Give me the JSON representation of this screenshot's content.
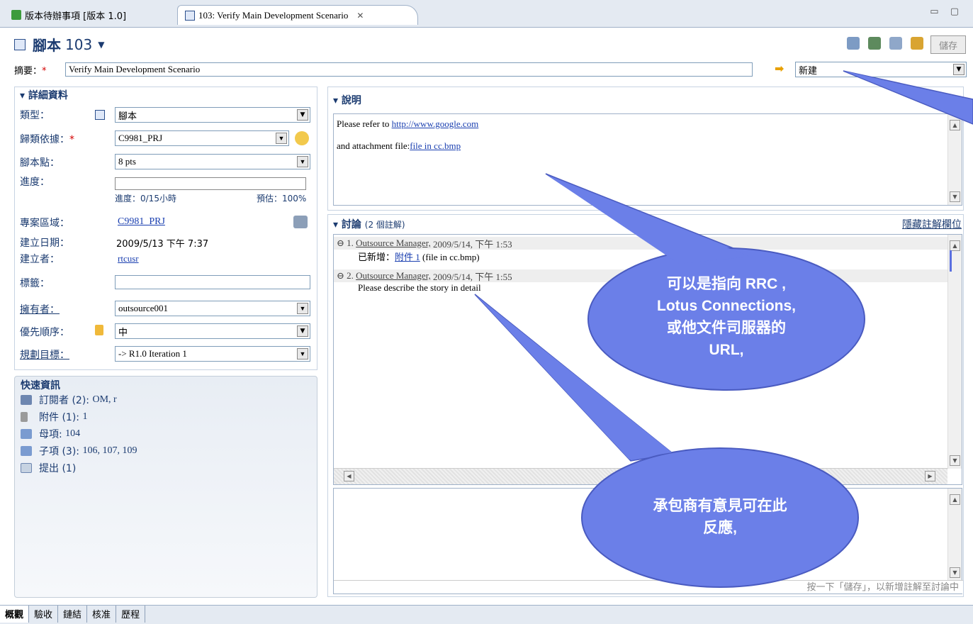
{
  "tabs": [
    {
      "label": "版本待辦事項 [版本 1.0]",
      "active": false
    },
    {
      "label": "103: Verify Main Development Scenario",
      "active": true
    }
  ],
  "header": {
    "title_prefix": "腳本",
    "number": "103",
    "save_label": "儲存"
  },
  "summary": {
    "label": "摘要：",
    "value": "Verify Main Development Scenario"
  },
  "state": {
    "value": "新建"
  },
  "details": {
    "title": "詳細資料",
    "type_label": "類型：",
    "type_value": "腳本",
    "filed_label": "歸類依據：",
    "filed_value": "C9981_PRJ",
    "points_label": "腳本點：",
    "points_value": "8 pts",
    "progress_label": "進度：",
    "progress_text": "進度：0/15小時",
    "estimate_text": "預估：100%",
    "progress_fraction": 0,
    "area_label": "專案區域：",
    "area_value": "C9981_PRJ",
    "created_label": "建立日期：",
    "created_value": "2009/5/13 下午 7:37",
    "creator_label": "建立者：",
    "creator_value": "rtcusr",
    "tags_label": "標籤：",
    "tags_value": "",
    "owner_label": "擁有者：",
    "owner_value": "outsource001",
    "priority_label": "優先順序：",
    "priority_value": "中",
    "planned_label": "規劃目標：",
    "planned_value": "-> R1.0 Iteration 1"
  },
  "quick_info": {
    "title": "快速資訊",
    "items": [
      {
        "label": "訂閱者 (2):",
        "value": "OM, r",
        "icon": "subscribers-icon"
      },
      {
        "label": "附件 (1):",
        "value": "1",
        "icon": "attachment-icon"
      },
      {
        "label": "母項:",
        "value": "104",
        "icon": "parent-icon"
      },
      {
        "label": "子項 (3):",
        "value": "106, 107, 109",
        "icon": "children-icon"
      },
      {
        "label": "提出 (1)",
        "value": "",
        "icon": "mentions-icon"
      }
    ]
  },
  "description": {
    "title": "說明",
    "line1_prefix": "Please refer to ",
    "line1_link": "http://www.google.com",
    "line2_prefix": "and attachment file:",
    "line2_link": "file in cc.bmp"
  },
  "discussion": {
    "title": "討論",
    "count": "(2 個註解)",
    "hide_link": "隱藏註解欄位",
    "comments": [
      {
        "num": "1.",
        "author": "Outsource Manager,",
        "date": "2009/5/14, 下午 1:53",
        "body_prefix": "已新增：",
        "body_link": "附件 1",
        "body_suffix": " (file in cc.bmp)"
      },
      {
        "num": "2.",
        "author": "Outsource Manager,",
        "date": "2009/5/14, 下午 1:55",
        "body_prefix": "Please describe the story in detail",
        "body_link": "",
        "body_suffix": ""
      }
    ],
    "hint": "按一下「儲存」，以新增註解至討論中"
  },
  "callouts": {
    "c1_line1": "可以是指向 RRC ,",
    "c1_line2": "Lotus Connections,",
    "c1_line3": "或他文件司服器的",
    "c1_line4": "URL,",
    "c2_line1": "承包商有意見可在此",
    "c2_line2": "反應,"
  },
  "bottom_tabs": [
    "概觀",
    "驗收",
    "鏈結",
    "核准",
    "歷程"
  ],
  "colors": {
    "callout": "#6b7fe8",
    "accent": "#1b3b70",
    "link": "#1a3fb0",
    "required": "#d40000"
  }
}
